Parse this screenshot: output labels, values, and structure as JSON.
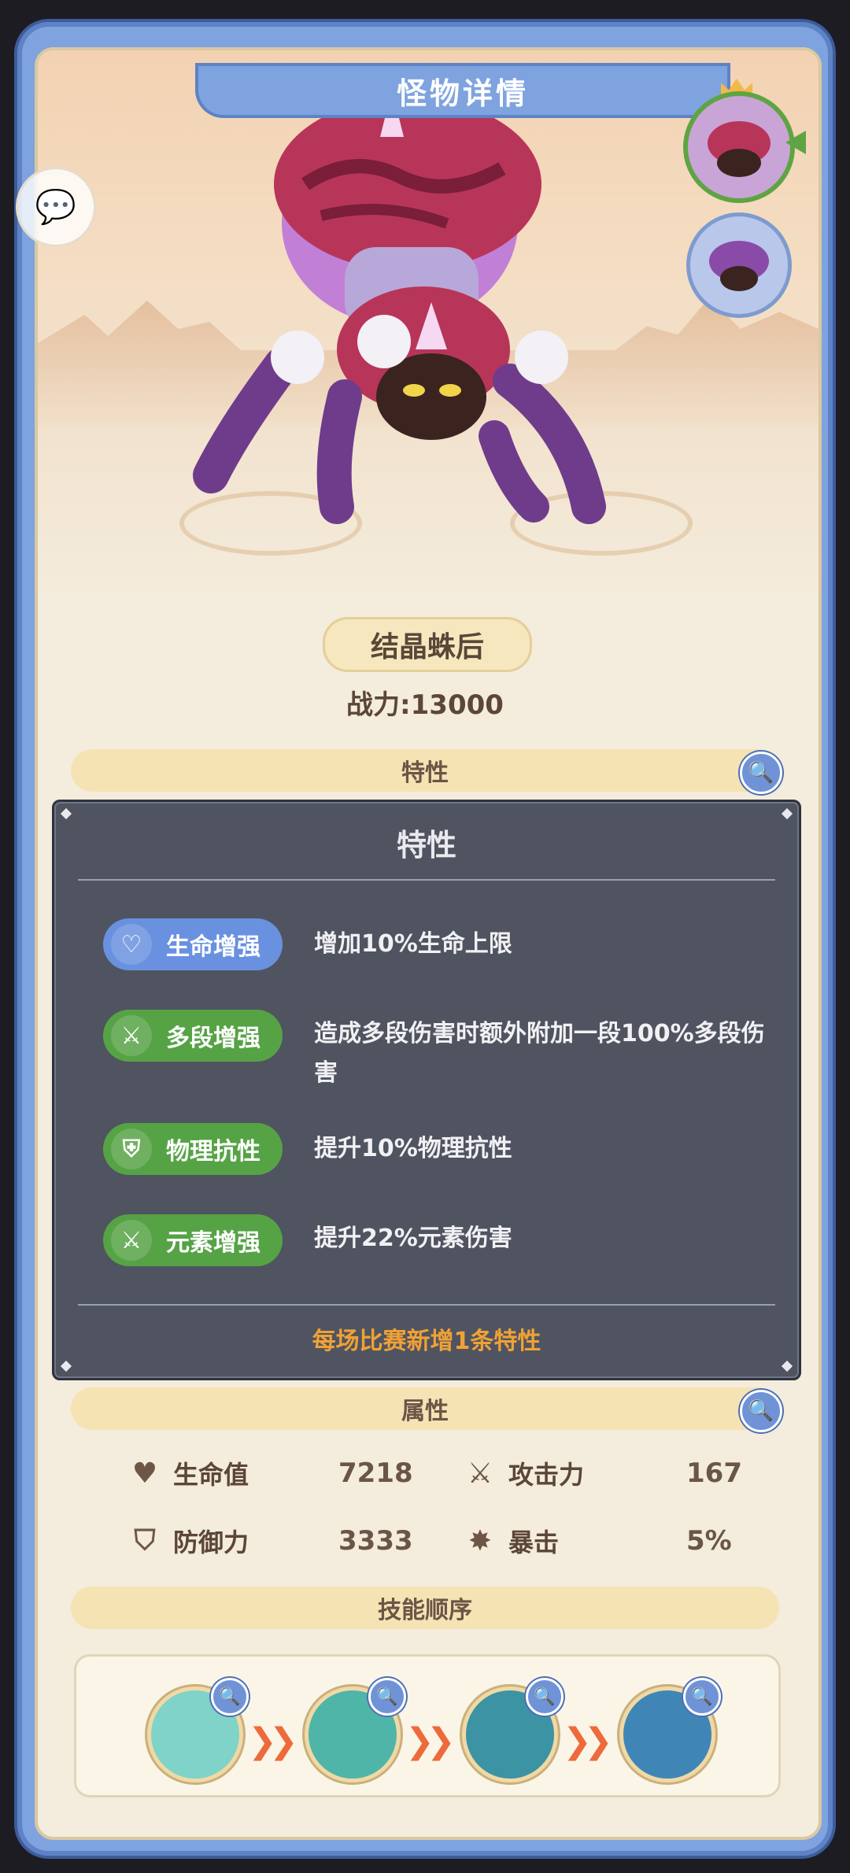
{
  "header": {
    "title": "怪物详情"
  },
  "monster": {
    "name": "结晶蛛后",
    "power": "战力:13000"
  },
  "sections": {
    "traits": "特性",
    "attributes": "属性",
    "skill_order": "技能顺序"
  },
  "attributes": {
    "hp_label": "生命值",
    "hp_value": "7218",
    "atk_label": "攻击力",
    "atk_value": "167",
    "def_label": "防御力",
    "def_value": "3333",
    "crit_label": "暴击",
    "crit_value": "5%"
  },
  "trait_popup": {
    "title": "特性",
    "traits": [
      {
        "name": "生命增强",
        "desc": "增加10%生命上限",
        "color": "#6a91e0",
        "icon": "heart-shield-icon"
      },
      {
        "name": "多段增强",
        "desc": "造成多段伤害时额外附加一段100%多段伤害",
        "color": "#56a346",
        "icon": "crossed-swords-icon"
      },
      {
        "name": "物理抗性",
        "desc": "提升10%物理抗性",
        "color": "#56a346",
        "icon": "shield-sword-icon"
      },
      {
        "name": "元素增强",
        "desc": "提升22%元素伤害",
        "color": "#56a346",
        "icon": "crossed-swords-icon"
      }
    ],
    "footer": "每场比赛新增1条特性"
  },
  "skills": [
    {
      "icon": "crystal-claw-skill-icon",
      "color": "#7fd3c8"
    },
    {
      "icon": "pig-bubble-skill-icon",
      "color": "#4fb5a8"
    },
    {
      "icon": "crystal-shard-skill-icon",
      "color": "#3c93a3"
    },
    {
      "icon": "rock-burst-skill-icon",
      "color": "#3f86b7"
    }
  ],
  "colors": {
    "frame": "#7fa3df",
    "panel": "#f4ecdc",
    "accent_orange": "#f0a136",
    "trait_blue": "#6a91e0",
    "trait_green": "#56a346"
  }
}
